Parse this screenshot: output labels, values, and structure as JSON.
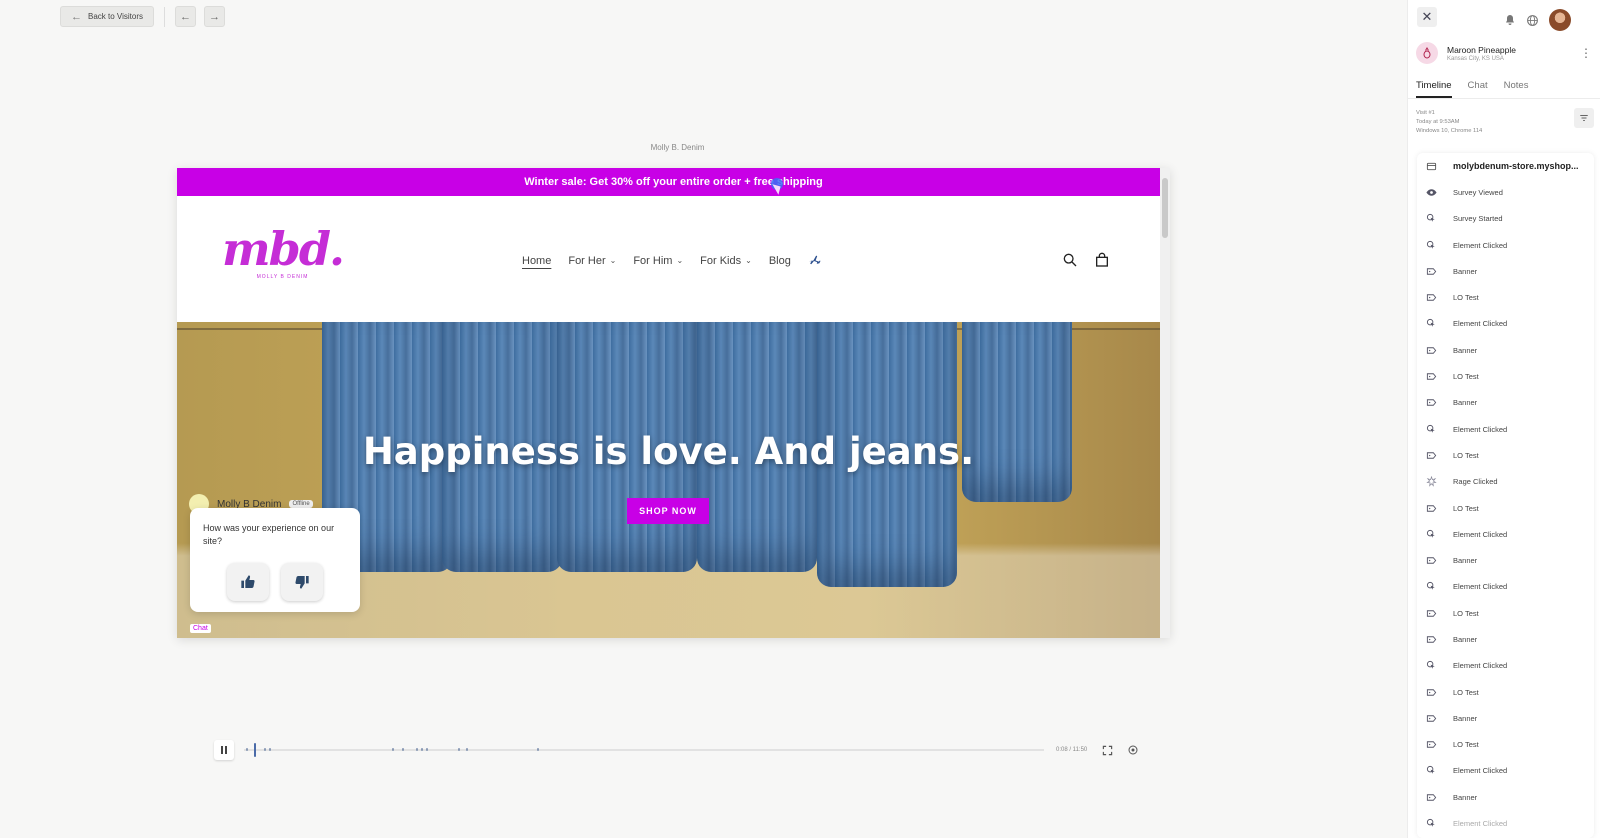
{
  "toolbar": {
    "back_label": "Back to Visitors"
  },
  "replay": {
    "site_name": "Molly B. Denim",
    "announcement": "Winter sale: Get 30% off your entire order + free shipping",
    "logo_text": "mbd.",
    "logo_sub": "MOLLY B DENIM",
    "nav": [
      {
        "label": "Home",
        "dropdown": false
      },
      {
        "label": "For Her",
        "dropdown": true
      },
      {
        "label": "For Him",
        "dropdown": true
      },
      {
        "label": "For Kids",
        "dropdown": true
      },
      {
        "label": "Blog",
        "dropdown": false
      }
    ],
    "hero_title": "Happiness is love. And jeans.",
    "shop_button": "SHOP NOW",
    "survey": {
      "sender": "Molly B Denim",
      "status": "Offline",
      "question": "How was your experience on our site?"
    },
    "chat_tag": "Chat"
  },
  "playback": {
    "time": "0:08 / 11:50"
  },
  "panel": {
    "visitor_name": "Maroon Pineapple",
    "visitor_location": "Kansas City, KS USA",
    "tabs": [
      "Timeline",
      "Chat",
      "Notes"
    ],
    "visit": {
      "number": "Visit #1",
      "when": "Today at 9:53AM",
      "system": "Windows 10, Chrome 114"
    },
    "events": [
      {
        "label": "molybdenum-store.myshop...",
        "icon": "page-icon"
      },
      {
        "label": "Survey Viewed",
        "icon": "eye-icon"
      },
      {
        "label": "Survey Started",
        "icon": "click-icon"
      },
      {
        "label": "Element Clicked",
        "icon": "click-icon"
      },
      {
        "label": "Banner",
        "icon": "tag-icon"
      },
      {
        "label": "LO Test",
        "icon": "tag-icon"
      },
      {
        "label": "Element Clicked",
        "icon": "click-icon"
      },
      {
        "label": "Banner",
        "icon": "tag-icon"
      },
      {
        "label": "LO Test",
        "icon": "tag-icon"
      },
      {
        "label": "Banner",
        "icon": "tag-icon"
      },
      {
        "label": "Element Clicked",
        "icon": "click-icon"
      },
      {
        "label": "LO Test",
        "icon": "tag-icon"
      },
      {
        "label": "Rage Clicked",
        "icon": "rage-icon"
      },
      {
        "label": "LO Test",
        "icon": "tag-icon"
      },
      {
        "label": "Element Clicked",
        "icon": "click-icon"
      },
      {
        "label": "Banner",
        "icon": "tag-icon"
      },
      {
        "label": "Element Clicked",
        "icon": "click-icon"
      },
      {
        "label": "LO Test",
        "icon": "tag-icon"
      },
      {
        "label": "Banner",
        "icon": "tag-icon"
      },
      {
        "label": "Element Clicked",
        "icon": "click-icon"
      },
      {
        "label": "LO Test",
        "icon": "tag-icon"
      },
      {
        "label": "Banner",
        "icon": "tag-icon"
      },
      {
        "label": "LO Test",
        "icon": "tag-icon"
      },
      {
        "label": "Element Clicked",
        "icon": "click-icon"
      },
      {
        "label": "Banner",
        "icon": "tag-icon"
      },
      {
        "label": "Element Clicked",
        "icon": "click-icon"
      }
    ]
  },
  "colors": {
    "brand": "#c800e6",
    "logo": "#c52dd6",
    "accent": "#4b6ba8"
  }
}
